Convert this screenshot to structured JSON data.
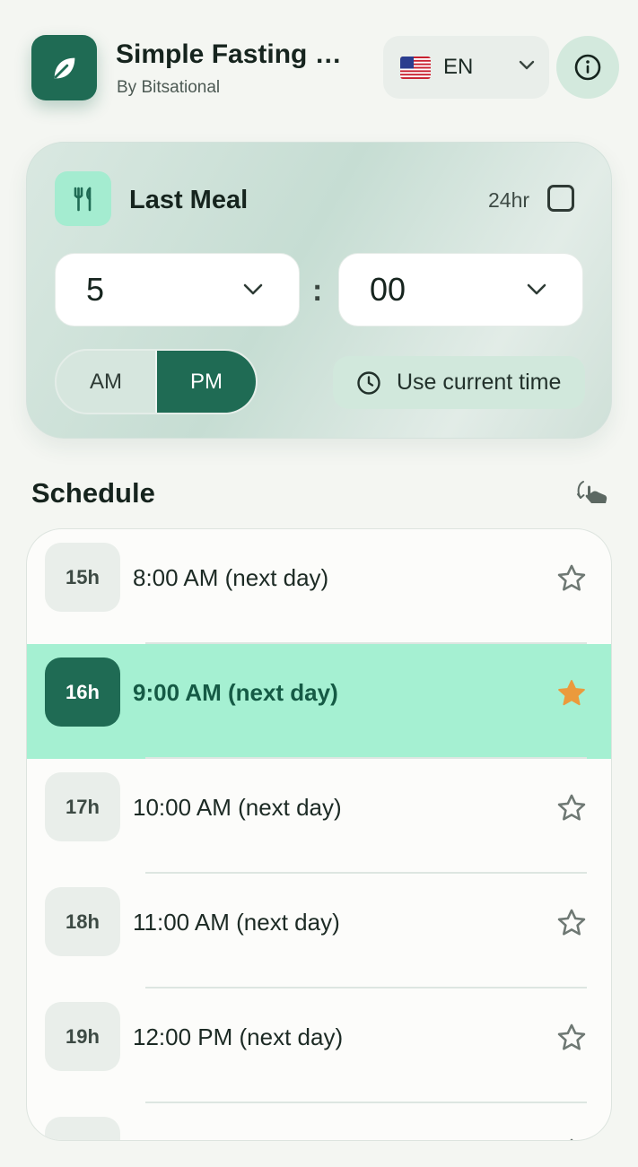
{
  "header": {
    "app_title": "Simple Fasting C...",
    "app_subtitle": "By Bitsational",
    "language": "EN",
    "logo_icon": "leaf-icon",
    "info_icon": "info-icon",
    "accent_color": "#1f6b54"
  },
  "last_meal": {
    "title": "Last Meal",
    "format_label": "24hr",
    "format_24hr_checked": false,
    "hour": "5",
    "separator": ":",
    "minute": "00",
    "am_label": "AM",
    "pm_label": "PM",
    "selected_period": "PM",
    "use_current_time_label": "Use current time"
  },
  "schedule": {
    "title": "Schedule",
    "rows": [
      {
        "hours": "15h",
        "time": "8:00 AM (next day)",
        "favorite": false,
        "selected": false
      },
      {
        "hours": "16h",
        "time": "9:00 AM (next day)",
        "favorite": true,
        "selected": true
      },
      {
        "hours": "17h",
        "time": "10:00 AM (next day)",
        "favorite": false,
        "selected": false
      },
      {
        "hours": "18h",
        "time": "11:00 AM (next day)",
        "favorite": false,
        "selected": false
      },
      {
        "hours": "19h",
        "time": "12:00 PM (next day)",
        "favorite": false,
        "selected": false
      },
      {
        "hours": "",
        "time": "",
        "favorite": false,
        "selected": false
      }
    ]
  },
  "colors": {
    "selected_row": "#a5f0d2",
    "favorite_star": "#eb9a3c"
  }
}
